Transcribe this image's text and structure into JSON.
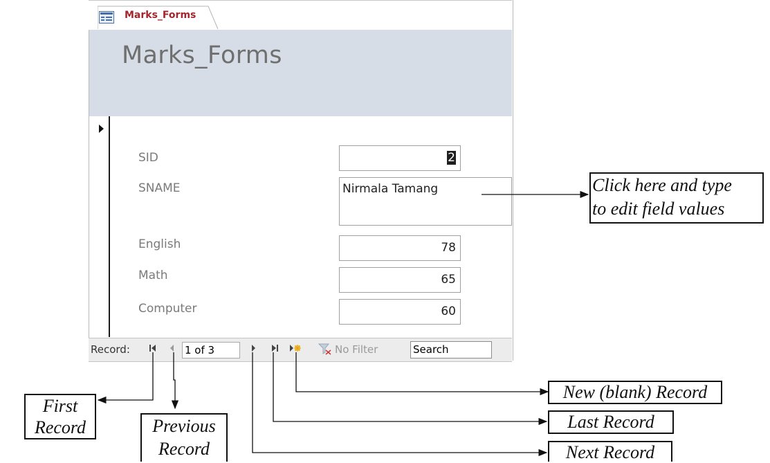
{
  "tab": {
    "label": "Marks_Forms"
  },
  "form": {
    "title": "Marks_Forms"
  },
  "fields": [
    {
      "label": "SID",
      "value": "2"
    },
    {
      "label": "SNAME",
      "value": "Nirmala Tamang"
    },
    {
      "label": "English",
      "value": "78"
    },
    {
      "label": "Math",
      "value": "65"
    },
    {
      "label": "Computer",
      "value": "60"
    }
  ],
  "navigation": {
    "record_label": "Record:",
    "record_position": "1 of 3",
    "filter_label": "No Filter",
    "search_text": "Search"
  },
  "callouts": {
    "edit_line1": "Click here and type",
    "edit_line2": "to edit field values",
    "first_line1": "First",
    "first_line2": "Record",
    "previous_line1": "Previous",
    "previous_line2": "Record",
    "new_record": "New (blank) Record",
    "last_record": "Last Record",
    "next_record": "Next Record"
  },
  "colors": {
    "header_bg": "#d7dde6",
    "tab_label": "#a4262c",
    "navbar_bg": "#ececec"
  }
}
